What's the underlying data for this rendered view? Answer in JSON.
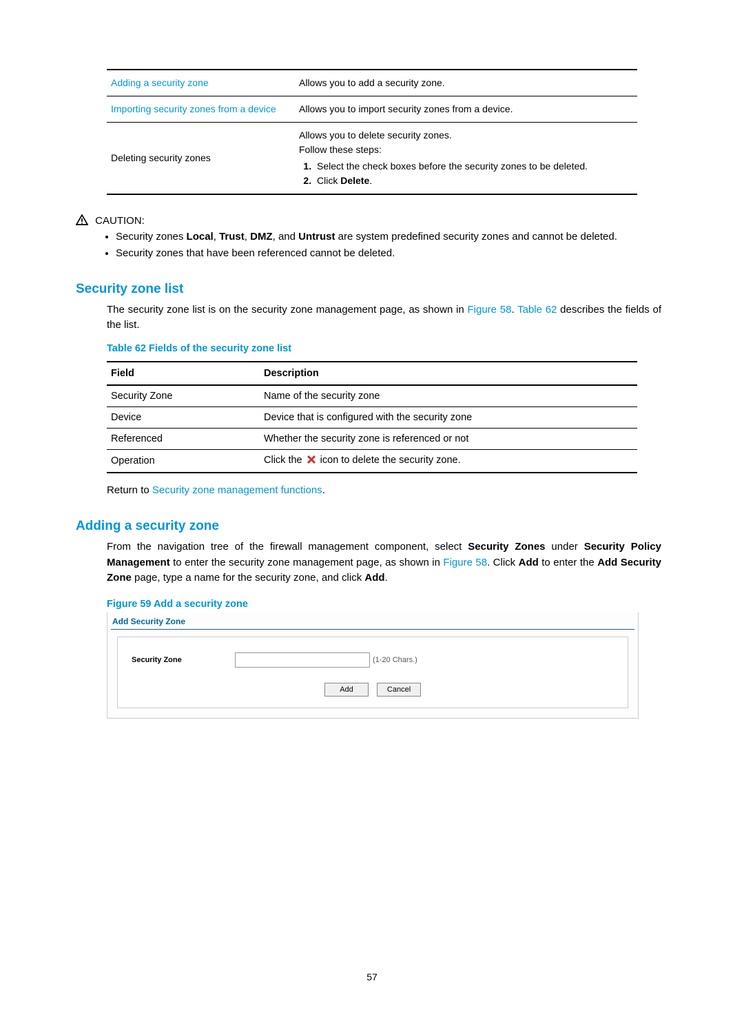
{
  "table1": {
    "rows": [
      {
        "left_link": "Adding a security zone",
        "right": "Allows you to add a security zone."
      },
      {
        "left_link": "Importing security zones from a device",
        "right": "Allows you to import security zones from a device."
      },
      {
        "left_text": "Deleting security zones",
        "right_line1": "Allows you to delete security zones.",
        "right_line2": "Follow these steps:",
        "right_step1": "Select the check boxes before the security zones to be deleted.",
        "right_step2_prefix": "Click ",
        "right_step2_bold": "Delete",
        "right_step2_suffix": "."
      }
    ]
  },
  "caution": {
    "label": "CAUTION:",
    "bullet1_prefix": "Security zones ",
    "bullet1_b1": "Local",
    "bullet1_c1": ", ",
    "bullet1_b2": "Trust",
    "bullet1_c2": ", ",
    "bullet1_b3": "DMZ",
    "bullet1_c3": ", and ",
    "bullet1_b4": "Untrust",
    "bullet1_suffix": " are system predefined security zones and cannot be deleted.",
    "bullet2": "Security zones that have been referenced cannot be deleted."
  },
  "section1": {
    "heading": "Security zone list",
    "para_prefix": "The security zone list is on the security zone management page, as shown in ",
    "link1": "Figure 58",
    "mid": ". ",
    "link2": "Table 62",
    "para_suffix": " describes the fields of the list.",
    "table_caption": "Table 62 Fields of the security zone list",
    "th1": "Field",
    "th2": "Description",
    "rows": [
      {
        "f": "Security Zone",
        "d": "Name of the security zone"
      },
      {
        "f": "Device",
        "d": "Device that is configured with the security zone"
      },
      {
        "f": "Referenced",
        "d": "Whether the security zone is referenced or not"
      },
      {
        "f": "Operation",
        "d_prefix": "Click the ",
        "d_suffix": " icon to delete the security zone."
      }
    ],
    "return_prefix": "Return to ",
    "return_link": "Security zone management functions",
    "return_suffix": "."
  },
  "section2": {
    "heading": "Adding a security zone",
    "p_prefix": "From the navigation tree of the firewall management component, select ",
    "p_b1": "Security Zones",
    "p_m1": " under ",
    "p_b2": "Security Policy Management",
    "p_m2": " to enter the security zone management page, as shown in ",
    "p_link": "Figure 58",
    "p_m3": ". Click ",
    "p_b3": "Add",
    "p_m4": " to enter the ",
    "p_b4": "Add Security Zone",
    "p_m5": " page, type a name for the security zone, and click ",
    "p_b5": "Add",
    "p_suffix": ".",
    "figure_caption": "Figure 59 Add a security zone",
    "figure_title": "Add Security Zone",
    "fig_label": "Security Zone",
    "fig_hint": "(1-20 Chars.)",
    "btn_add": "Add",
    "btn_cancel": "Cancel"
  },
  "page_number": "57"
}
